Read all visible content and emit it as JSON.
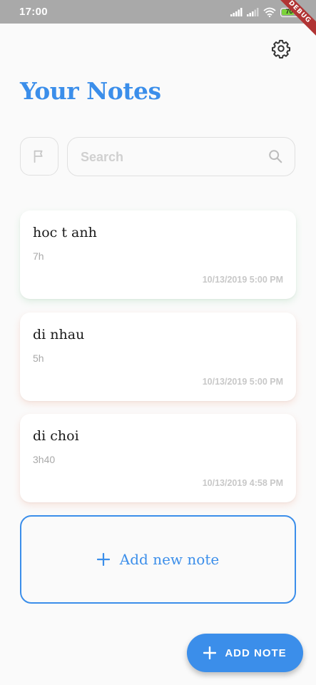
{
  "status_bar": {
    "time": "17:00",
    "battery": "70",
    "debug_banner": "DEBUG"
  },
  "header": {
    "title": "Your Notes",
    "settings_icon": "gear-icon"
  },
  "search": {
    "placeholder": "Search",
    "value": ""
  },
  "filter": {
    "icon": "flag-icon"
  },
  "notes": [
    {
      "title": "hoc t anh",
      "body": "7h",
      "date": "10/13/2019 5:00 PM"
    },
    {
      "title": "di nhau",
      "body": "5h",
      "date": "10/13/2019 5:00 PM"
    },
    {
      "title": "di choi",
      "body": "3h40",
      "date": "10/13/2019 4:58 PM"
    }
  ],
  "add_card": {
    "label": "Add new note"
  },
  "fab": {
    "label": "ADD NOTE"
  },
  "colors": {
    "accent": "#3b8eea",
    "background": "#fafafa",
    "status_bar": "#a9a9a9"
  }
}
